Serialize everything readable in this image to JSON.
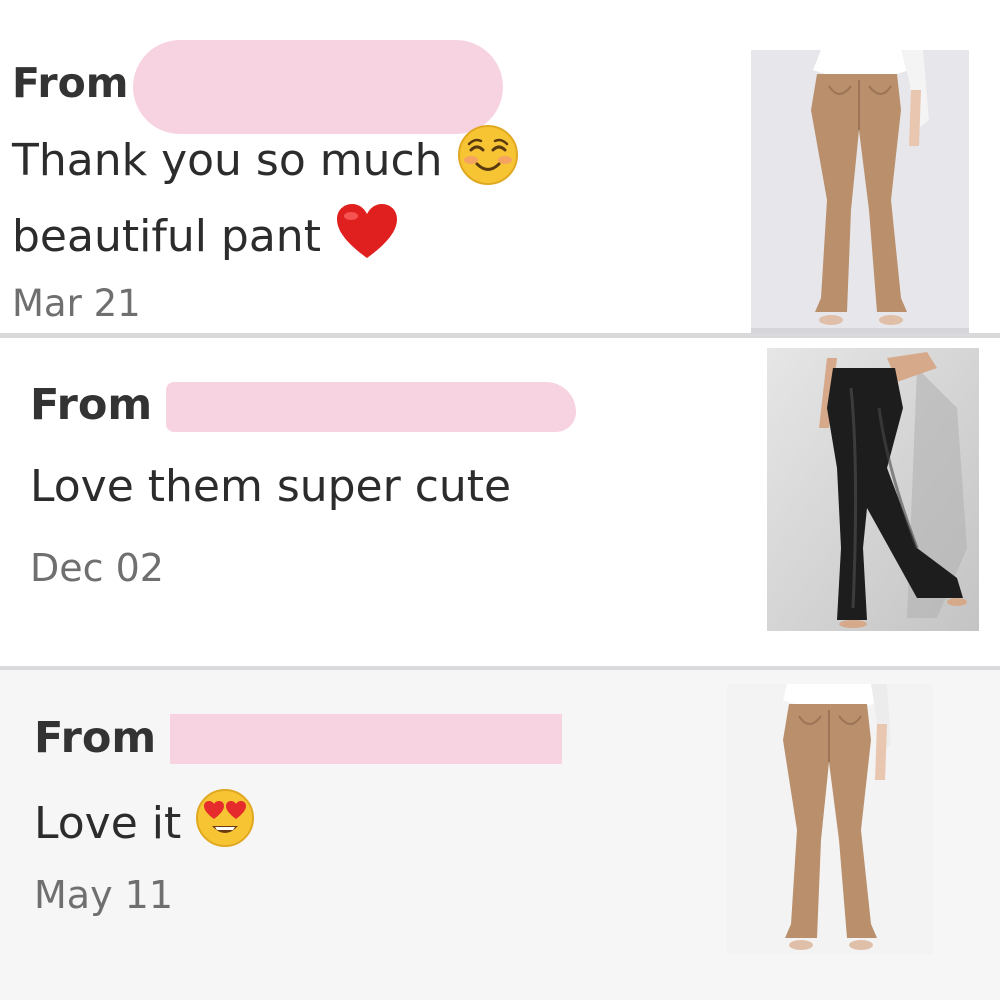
{
  "reviews": [
    {
      "from_label": "From",
      "message_lines": [
        "Thank you so much",
        "beautiful pant"
      ],
      "emojis": [
        "smiling-face-icon",
        "red-heart-icon"
      ],
      "date": "Mar 21",
      "product_image": "tan-flare-pants"
    },
    {
      "from_label": "From",
      "message_lines": [
        "Love them super cute"
      ],
      "emojis": [],
      "date": "Dec 02",
      "product_image": "black-leather-flare-pants"
    },
    {
      "from_label": "From",
      "message_lines": [
        "Love it"
      ],
      "emojis": [
        "heart-eyes-icon"
      ],
      "date": "May 11",
      "product_image": "tan-flare-pants"
    }
  ],
  "colors": {
    "redaction": "#f7d3e2",
    "divider": "#d9d9db",
    "text": "#2c2c2c",
    "date_text": "#6f6f6f",
    "tan_pants": "#b98f6c",
    "black_pants": "#1d1d1d"
  }
}
